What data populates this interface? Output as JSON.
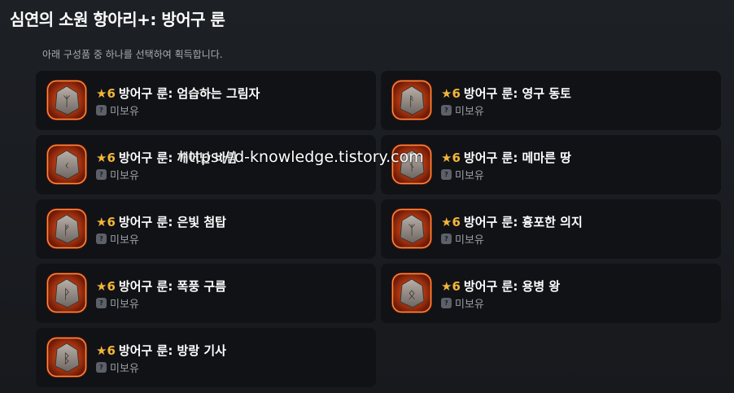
{
  "page": {
    "title": "심연의 소원 항아리+: 방어구 룬",
    "subtitle": "아래 구성품 중 하나를 선택하여 획득합니다."
  },
  "items": [
    {
      "star": "★",
      "grade": "6",
      "name": "방어구 룬: 엄습하는 그림자",
      "status": "미보유",
      "glyph": "ᛉ"
    },
    {
      "star": "★",
      "grade": "6",
      "name": "방어구 룬: 영구 동토",
      "status": "미보유",
      "glyph": "ᚨ"
    },
    {
      "star": "★",
      "grade": "6",
      "name": "방어구 룬: 깨어난 바람",
      "status": "미보유",
      "glyph": "ᚲ"
    },
    {
      "star": "★",
      "grade": "6",
      "name": "방어구 룬: 메마른 땅",
      "status": "미보유",
      "glyph": "ᚾ"
    },
    {
      "star": "★",
      "grade": "6",
      "name": "방어구 룬: 은빛 첨탑",
      "status": "미보유",
      "glyph": "ᚠ"
    },
    {
      "star": "★",
      "grade": "6",
      "name": "방어구 룬: 흉포한 의지",
      "status": "미보유",
      "glyph": "ᛉ"
    },
    {
      "star": "★",
      "grade": "6",
      "name": "방어구 룬: 폭풍 구름",
      "status": "미보유",
      "glyph": "ᚹ"
    },
    {
      "star": "★",
      "grade": "6",
      "name": "방어구 룬: 용병 왕",
      "status": "미보유",
      "glyph": "ᛟ"
    },
    {
      "star": "★",
      "grade": "6",
      "name": "방어구 룬: 방랑 기사",
      "status": "미보유",
      "glyph": "ᛒ"
    }
  ],
  "status_icon_label": "?",
  "watermark": "https://d-knowledge.tistory.com",
  "colors": {
    "accent_star": "#f3b53a",
    "rune_glow": "#ff6a1a",
    "card_bg": "#101216"
  }
}
